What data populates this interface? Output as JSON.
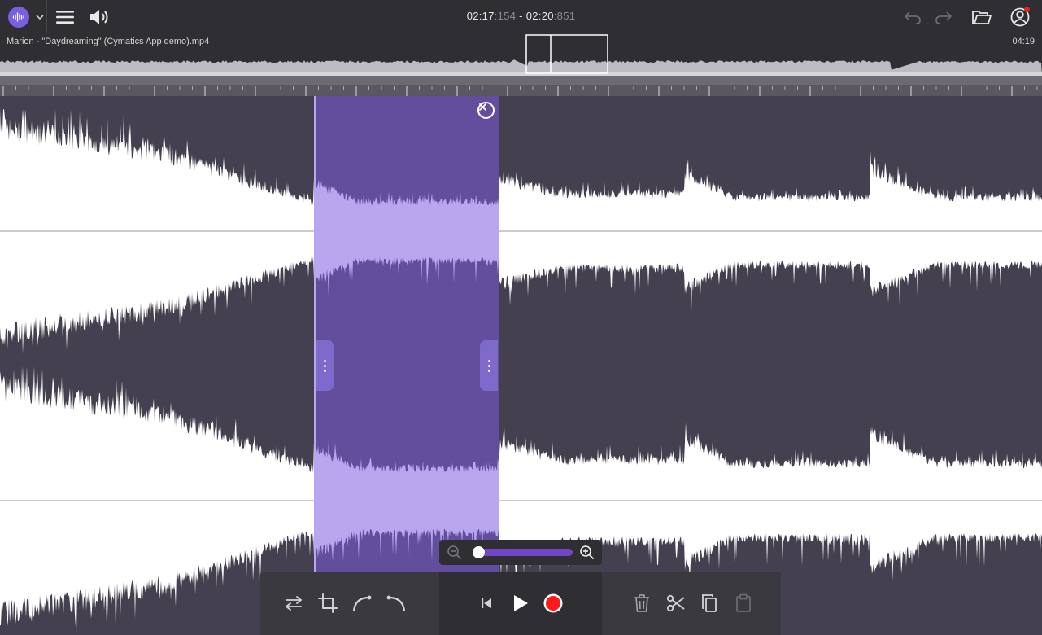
{
  "header": {
    "logo_icon": "waveform-logo-icon",
    "selection_start_main": "02:17",
    "selection_start_ms": ":154",
    "separator": " - ",
    "selection_end_main": "02:20",
    "selection_end_ms": ":851",
    "notification_badge_color": "#e02424"
  },
  "file": {
    "name": "Marion - \"Daydreaming\" (Cymatics App demo).mp4",
    "duration": "04:19"
  },
  "zoom": {
    "level": 0.03
  },
  "colors": {
    "accent": "#7a5ee0",
    "selection": "#6a52b0",
    "waveform": "#ffffff",
    "waveform_selected": "#b9a6ee",
    "background": "#45404f",
    "record": "#ff1a1a"
  },
  "icons": {
    "menu": "hamburger-menu-icon",
    "volume": "speaker-volume-icon",
    "undo": "undo-icon",
    "redo": "redo-icon",
    "open": "folder-open-icon",
    "account": "user-account-icon",
    "swap": "swap-channels-icon",
    "crop": "crop-icon",
    "fade_in": "fade-in-icon",
    "fade_out": "fade-out-icon",
    "skip_start": "skip-to-start-icon",
    "play": "play-icon",
    "record": "record-icon",
    "delete": "trash-icon",
    "cut": "scissors-icon",
    "copy": "copy-icon",
    "paste": "paste-icon"
  }
}
